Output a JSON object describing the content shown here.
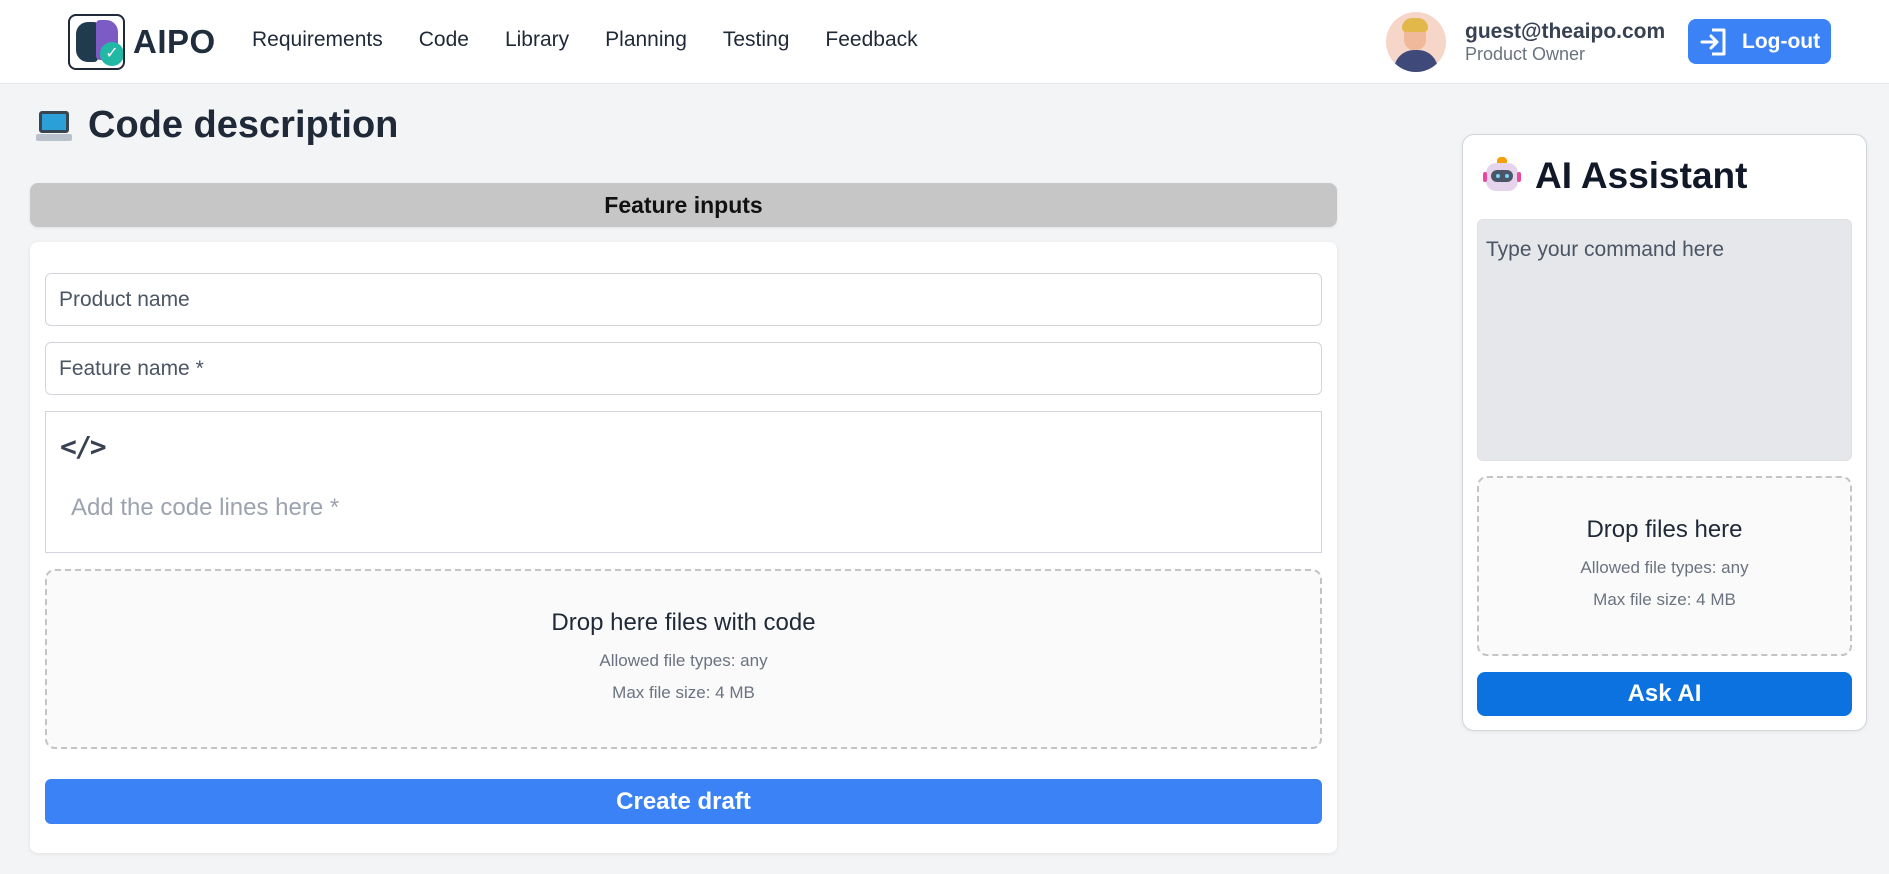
{
  "brand": {
    "name": "AIPO"
  },
  "nav": {
    "items": [
      {
        "label": "Requirements"
      },
      {
        "label": "Code"
      },
      {
        "label": "Library"
      },
      {
        "label": "Planning"
      },
      {
        "label": "Testing"
      },
      {
        "label": "Feedback"
      }
    ]
  },
  "user": {
    "email": "guest@theaipo.com",
    "role": "Product Owner",
    "logout_label": "Log-out"
  },
  "page": {
    "title": "Code description"
  },
  "feature": {
    "header": "Feature inputs",
    "product_placeholder": "Product name",
    "feature_placeholder": "Feature name *",
    "code_icon": "</>",
    "code_placeholder": "Add the code lines here *",
    "drop_title": "Drop here files with code",
    "drop_types": "Allowed file types: any",
    "drop_size": "Max file size: 4 MB",
    "create_label": "Create draft"
  },
  "assistant": {
    "title": "AI Assistant",
    "input_placeholder": "Type your command here",
    "drop_title": "Drop files here",
    "drop_types": "Allowed file types: any",
    "drop_size": "Max file size: 4 MB",
    "ask_label": "Ask AI"
  },
  "colors": {
    "primary": "#3b82f6",
    "ask_button": "#0b72e0",
    "section_header": "#c6c6c6",
    "background": "#f3f4f6"
  },
  "icons": {
    "logo": "aipo-logo-icon",
    "logout": "logout-icon",
    "page": "laptop-icon",
    "code": "code-icon",
    "assistant": "robot-icon"
  }
}
